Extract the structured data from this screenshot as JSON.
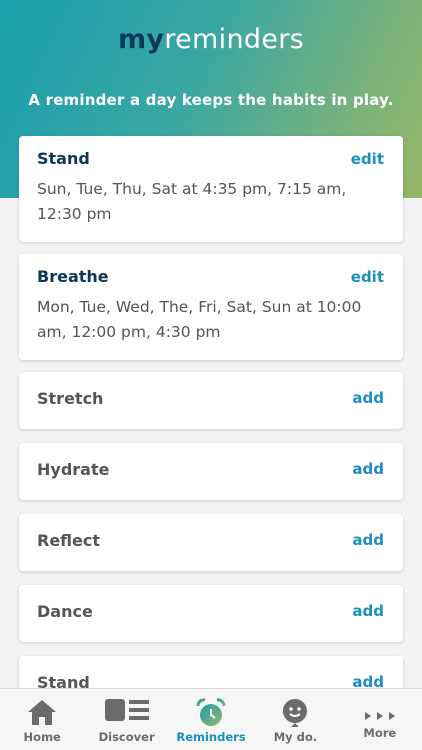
{
  "header": {
    "logo_prefix": "my",
    "logo_suffix": "reminders",
    "tagline": "A reminder a day keeps the habits in play."
  },
  "reminders": [
    {
      "title": "Stand",
      "action": "edit",
      "detail": "Sun, Tue, Thu, Sat at 4:35 pm, 7:15 am, 12:30 pm"
    },
    {
      "title": "Breathe",
      "action": "edit",
      "detail": "Mon, Tue, Wed, The, Fri, Sat, Sun at 10:00 am, 12:00 pm, 4:30 pm"
    },
    {
      "title": "Stretch",
      "action": "add"
    },
    {
      "title": "Hydrate",
      "action": "add"
    },
    {
      "title": "Reflect",
      "action": "add"
    },
    {
      "title": "Dance",
      "action": "add"
    },
    {
      "title": "Stand",
      "action": "add"
    }
  ],
  "tabbar": {
    "tabs": [
      {
        "label": "Home",
        "icon": "home-icon"
      },
      {
        "label": "Discover",
        "icon": "discover-icon"
      },
      {
        "label": "Reminders",
        "icon": "alarm-clock-icon",
        "selected": true
      },
      {
        "label": "My do.",
        "icon": "smiley-pin-icon"
      },
      {
        "label": "More",
        "icon": "more-arrows-icon"
      }
    ]
  },
  "colors": {
    "accent": "#1b8fbd",
    "title_dark": "#0d3557",
    "gradient_start": "#1a9fad",
    "gradient_end": "#96b767"
  }
}
